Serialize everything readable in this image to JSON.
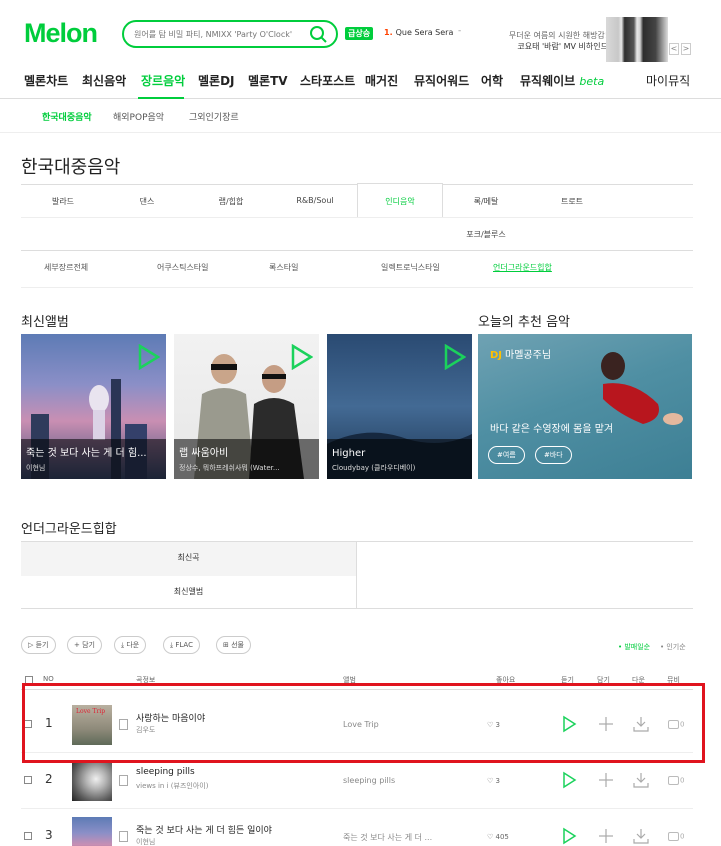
{
  "header": {
    "logo": "Melon",
    "search_placeholder": "원어를 탐 비밀 파티, NMIXX 'Party O'Clock'",
    "badge": "급상승",
    "rank_num": "1.",
    "rank_title": "Que Sera Sera",
    "rank_arrow": "-",
    "promo_line1": "무더운 여름의 시원한 해방감!",
    "promo_line2": "코요태 '바람' MV 비하인드",
    "promo_prev": "<",
    "promo_next": ">"
  },
  "gnb": [
    "멜론차트",
    "최신음악",
    "장르음악",
    "멜론DJ",
    "멜론TV",
    "스타포스트",
    "매거진",
    "뮤직어워드",
    "어학",
    "뮤직웨이브"
  ],
  "gnb_beta": "beta",
  "gnb_my": "마이뮤직",
  "subnav": [
    "한국대중음악",
    "해외POP음악",
    "그외인기장르"
  ],
  "page_title": "한국대중음악",
  "genre_tabs": [
    "발라드",
    "댄스",
    "랩/힙합",
    "R&B/Soul",
    "인디음악",
    "록/메탈",
    "트로트",
    "포크/블루스"
  ],
  "style_tabs": [
    "세부장르전체",
    "어쿠스틱스타일",
    "록스타일",
    "일렉트로닉스타일",
    "언더그라운드힙합"
  ],
  "latest_album_title": "최신앨범",
  "albums": [
    {
      "title": "죽는 것 보다 사는 게 더 힘...",
      "artist": "이현님"
    },
    {
      "title": "랩 싸움아비",
      "artist": "정상수, 뭐하프레쉬사뭐 (Water..."
    },
    {
      "title": "Higher",
      "artist": "Cloudybay (클라우디베이)"
    }
  ],
  "recommend_title": "오늘의 추천 음악",
  "recommend": {
    "dj": "DJ",
    "dj_name": "마멜공주님",
    "text": "바다 같은 수영장에 몸을 맡겨",
    "tags": [
      "#여름",
      "#바다"
    ]
  },
  "ug_title": "언더그라운드힙합",
  "ug_tabs": [
    "최신곡",
    "최신앨범"
  ],
  "buttons": [
    "듣기",
    "담기",
    "다운",
    "FLAC",
    "선물"
  ],
  "sort": [
    "• 발매일순",
    "• 인기순"
  ],
  "columns": [
    "NO",
    "곡정보",
    "앨범",
    "좋아요",
    "듣기",
    "담기",
    "다운",
    "뮤비"
  ],
  "songs": [
    {
      "no": "1",
      "title": "사랑하는 마음이야",
      "artist": "김우도",
      "album": "Love Trip",
      "likes": "3",
      "mv": "0",
      "thumb_text": "Love Trip"
    },
    {
      "no": "2",
      "title": "sleeping pills",
      "artist": "views in i (뷰즈인아이)",
      "album": "sleeping pills",
      "likes": "3",
      "mv": "0",
      "thumb_text": ""
    },
    {
      "no": "3",
      "title": "죽는 것 보다 사는 게 더 힘든 일이야",
      "artist": "이현님",
      "album": "죽는 것 보다 사는 게 더 ...",
      "likes": "405",
      "mv": "0",
      "thumb_text": ""
    }
  ],
  "colors": {
    "accent": "#00cd3c",
    "highlight_box": "#e0141e"
  }
}
